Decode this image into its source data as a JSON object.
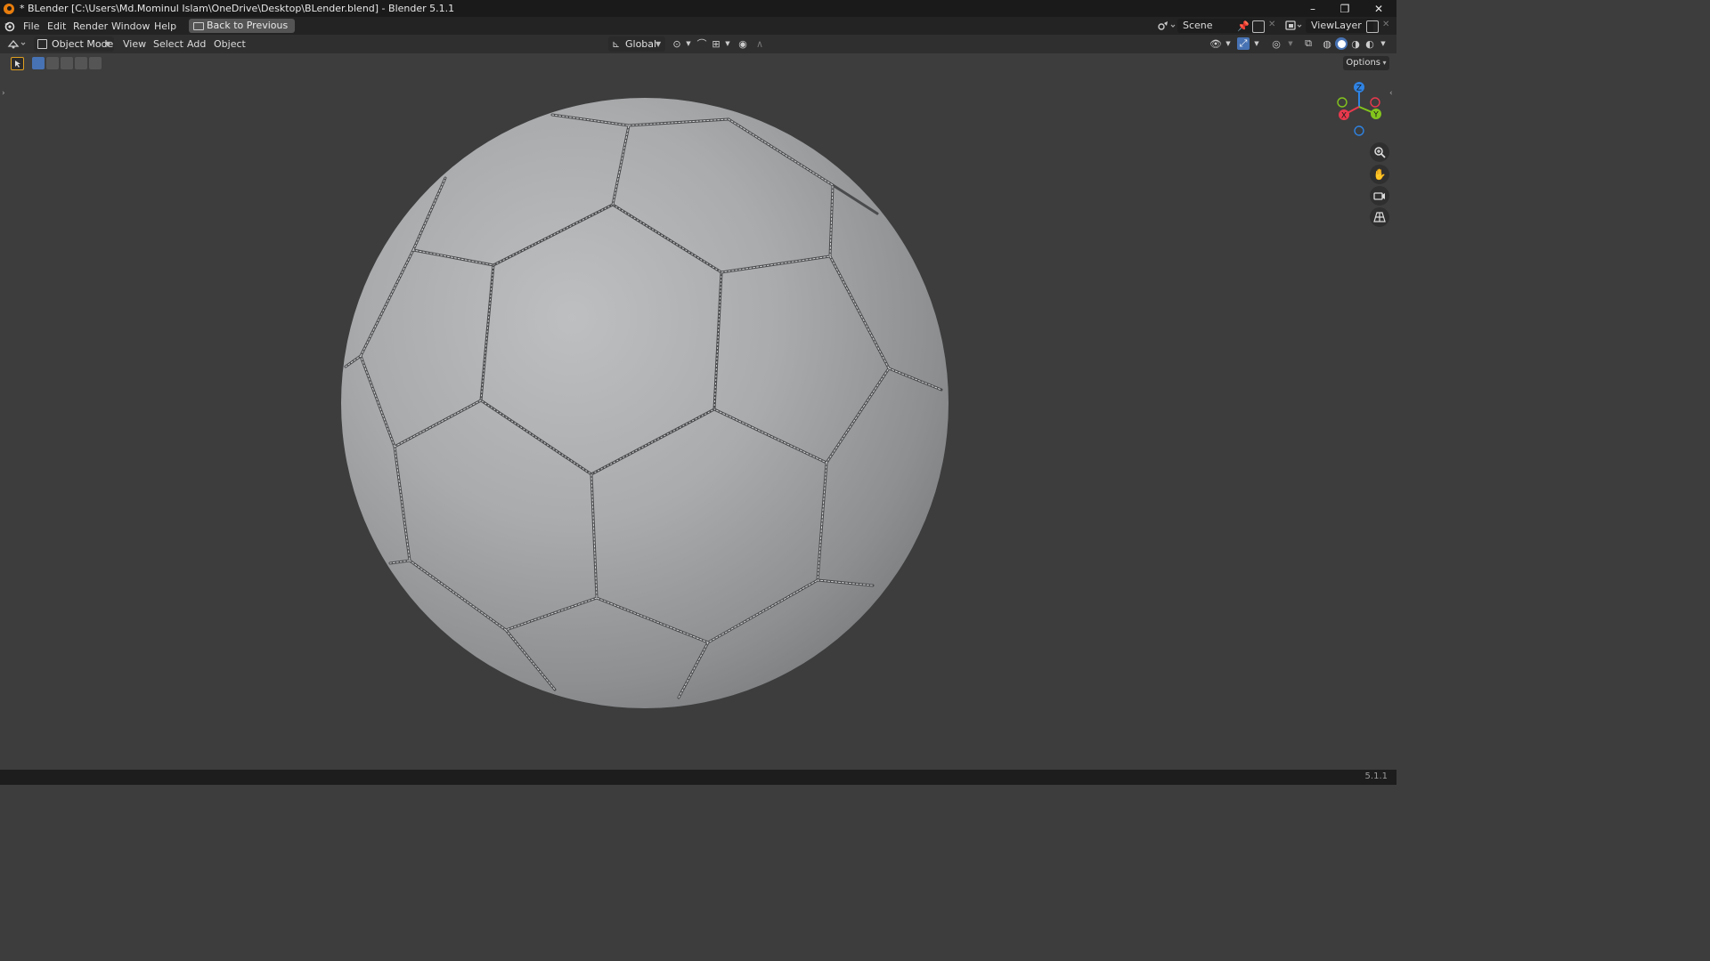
{
  "window": {
    "title": "* BLender [C:\\Users\\Md.Mominul Islam\\OneDrive\\Desktop\\BLender.blend] - Blender 5.1.1",
    "app_icon": "blender-icon",
    "controls": {
      "minimize": "–",
      "maximize": "❐",
      "close": "✕"
    }
  },
  "menubar": {
    "items": [
      "File",
      "Edit",
      "Render",
      "Window",
      "Help"
    ],
    "back_button": "Back to Previous",
    "scene_field": "Scene",
    "viewlayer_field": "ViewLayer"
  },
  "viewport_header": {
    "mode": "Object Mode",
    "menus": [
      "View",
      "Select",
      "Add",
      "Object"
    ],
    "orientation": "Global",
    "options": "Options"
  },
  "gizmo": {
    "z": "Z",
    "x": "X",
    "y": "Y"
  },
  "statusbar": {
    "version": "5.1.1"
  },
  "colors": {
    "axis_x": "#e8394d",
    "axis_y": "#83c51d",
    "axis_z": "#2f83e3",
    "accent_blue": "#4772b3",
    "ball": "#a9abad"
  }
}
